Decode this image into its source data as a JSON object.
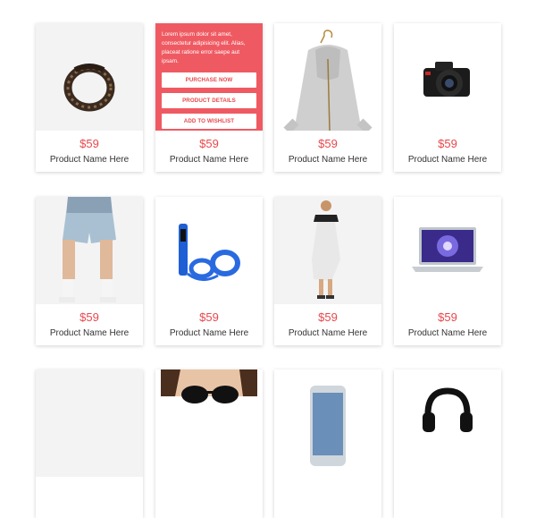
{
  "colors": {
    "accent": "#e8474c",
    "overlay": "#ef5a62"
  },
  "products": [
    {
      "image": "headband-image",
      "price": "$59",
      "name": "Product Name Here"
    },
    {
      "image": "hover-overlay",
      "price": "$59",
      "name": "Product Name Here",
      "overlay": {
        "text": "Lorem ipsum dolor sit amet, consectetur adipisicing elit. Alias, placeat ratione error saepe aut ipsam.",
        "buttons": [
          "PURCHASE NOW",
          "PRODUCT DETAILS",
          "ADD TO WISHLIST"
        ]
      }
    },
    {
      "image": "hoodie-image",
      "price": "$59",
      "name": "Product Name Here"
    },
    {
      "image": "camera-image",
      "price": "$59",
      "name": "Product Name Here"
    },
    {
      "image": "shorts-model-image",
      "price": "$59",
      "name": "Product Name Here"
    },
    {
      "image": "earphones-image",
      "price": "$59",
      "name": "Product Name Here"
    },
    {
      "image": "dress-model-image",
      "price": "$59",
      "name": "Product Name Here"
    },
    {
      "image": "laptop-image",
      "price": "$59",
      "name": "Product Name Here"
    },
    {
      "image": "blank-image",
      "price": "",
      "name": ""
    },
    {
      "image": "sunglasses-model-image",
      "price": "",
      "name": ""
    },
    {
      "image": "phone-image",
      "price": "",
      "name": ""
    },
    {
      "image": "headphones-image",
      "price": "",
      "name": ""
    }
  ]
}
